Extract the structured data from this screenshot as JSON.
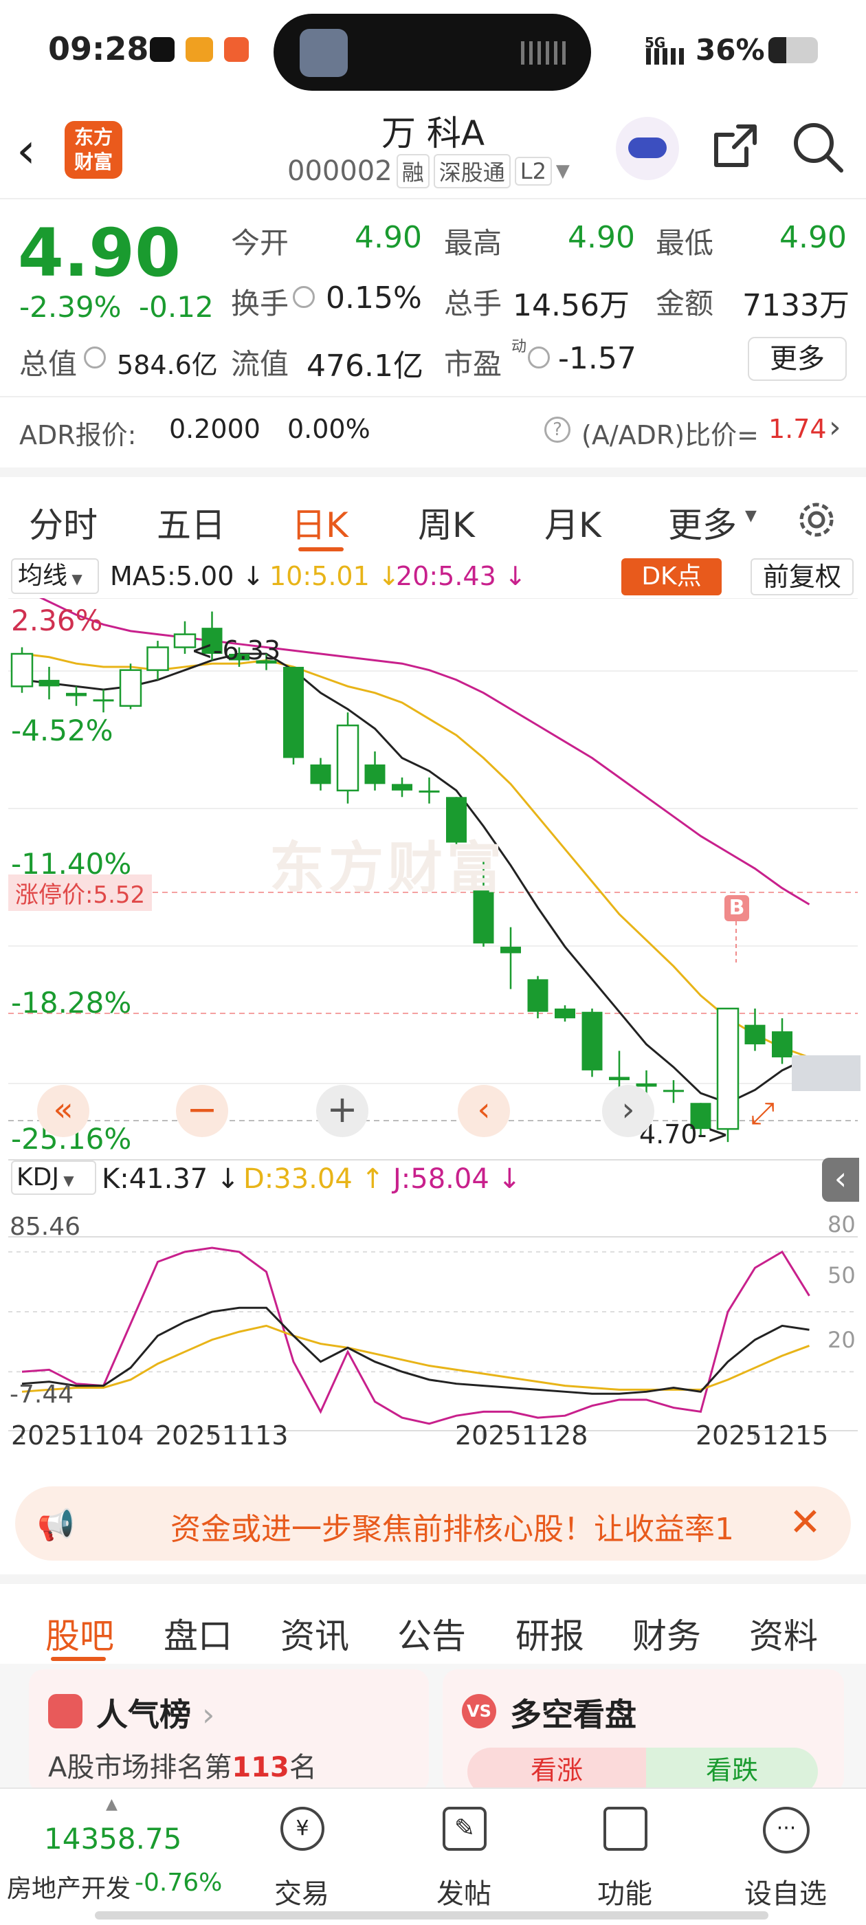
{
  "status": {
    "time": "09:28",
    "signal": "5G",
    "battery": "36%"
  },
  "nav": {
    "title": "万 科A",
    "code": "000002",
    "tags": [
      "融",
      "深股通",
      "L2"
    ],
    "logo_line1": "东方",
    "logo_line2": "财富"
  },
  "quote": {
    "price": "4.90",
    "change_pct": "-2.39%",
    "change_amt": "-0.12",
    "open_label": "今开",
    "open": "4.90",
    "high_label": "最高",
    "high": "4.90",
    "low_label": "最低",
    "low": "4.90",
    "turnover_label": "换手",
    "turnover": "0.15%",
    "volume_label": "总手",
    "volume": "14.56万",
    "amount_label": "金额",
    "amount": "7133万",
    "mcap_label": "总值",
    "mcap": "584.6亿",
    "float_label": "流值",
    "float": "476.1亿",
    "pe_label": "市盈",
    "pe_sup": "动",
    "pe": "-1.57",
    "more": "更多",
    "adr_label": "ADR报价:",
    "adr_price": "0.2000",
    "adr_pct": "0.00%",
    "adr_ratio_label": "(A/ADR)比价=",
    "adr_ratio": "1.74"
  },
  "tabs": [
    "分时",
    "五日",
    "日K",
    "周K",
    "月K",
    "更多"
  ],
  "chart_data": [
    {
      "type": "candlestick",
      "ma_label": "均线",
      "ma5": "MA5:5.00",
      "ma10": "10:5.01",
      "ma20": "20:5.43",
      "dk_label": "DK点",
      "adjust_label": "前复权",
      "y_ticks": [
        "2.36%",
        "-4.52%",
        "-11.40%",
        "-18.28%",
        "-25.16%"
      ],
      "limit_up_label": "涨停价:5.52",
      "high_annotation": "<-6.33",
      "low_annotation": "4.70->",
      "buy_marker": "B",
      "watermark": "东方财富",
      "candles": [
        {
          "o": 6.1,
          "c": 6.2,
          "h": 6.22,
          "l": 6.08
        },
        {
          "o": 6.12,
          "c": 6.1,
          "h": 6.16,
          "l": 6.06
        },
        {
          "o": 6.08,
          "c": 6.07,
          "h": 6.1,
          "l": 6.04
        },
        {
          "o": 6.06,
          "c": 6.06,
          "h": 6.09,
          "l": 6.02
        },
        {
          "o": 6.04,
          "c": 6.15,
          "h": 6.17,
          "l": 6.03
        },
        {
          "o": 6.15,
          "c": 6.22,
          "h": 6.24,
          "l": 6.12
        },
        {
          "o": 6.22,
          "c": 6.26,
          "h": 6.3,
          "l": 6.2
        },
        {
          "o": 6.28,
          "c": 6.2,
          "h": 6.33,
          "l": 6.18
        },
        {
          "o": 6.2,
          "c": 6.18,
          "h": 6.22,
          "l": 6.16
        },
        {
          "o": 6.18,
          "c": 6.17,
          "h": 6.2,
          "l": 6.15
        },
        {
          "o": 6.16,
          "c": 5.88,
          "h": 6.16,
          "l": 5.86
        },
        {
          "o": 5.86,
          "c": 5.8,
          "h": 5.88,
          "l": 5.78
        },
        {
          "o": 5.78,
          "c": 5.98,
          "h": 6.02,
          "l": 5.74
        },
        {
          "o": 5.86,
          "c": 5.8,
          "h": 5.9,
          "l": 5.78
        },
        {
          "o": 5.8,
          "c": 5.78,
          "h": 5.82,
          "l": 5.76
        },
        {
          "o": 5.78,
          "c": 5.78,
          "h": 5.82,
          "l": 5.74
        },
        {
          "o": 5.76,
          "c": 5.62,
          "h": 5.76,
          "l": 5.6
        },
        {
          "o": 5.48,
          "c": 5.31,
          "h": 5.57,
          "l": 5.3
        },
        {
          "o": 5.3,
          "c": 5.28,
          "h": 5.36,
          "l": 5.17
        },
        {
          "o": 5.2,
          "c": 5.1,
          "h": 5.21,
          "l": 5.08
        },
        {
          "o": 5.11,
          "c": 5.08,
          "h": 5.12,
          "l": 5.07
        },
        {
          "o": 5.1,
          "c": 4.92,
          "h": 5.11,
          "l": 4.9
        },
        {
          "o": 4.9,
          "c": 4.89,
          "h": 4.98,
          "l": 4.83
        },
        {
          "o": 4.88,
          "c": 4.87,
          "h": 4.92,
          "l": 4.82
        },
        {
          "o": 4.86,
          "c": 4.86,
          "h": 4.89,
          "l": 4.82
        },
        {
          "o": 4.82,
          "c": 4.74,
          "h": 4.82,
          "l": 4.72
        },
        {
          "o": 4.74,
          "c": 5.11,
          "h": 5.11,
          "l": 4.7
        },
        {
          "o": 5.06,
          "c": 5.0,
          "h": 5.11,
          "l": 4.98
        },
        {
          "o": 5.04,
          "c": 4.96,
          "h": 5.08,
          "l": 4.94
        },
        {
          "o": 4.9,
          "c": 4.9,
          "h": 4.9,
          "l": 4.9
        }
      ],
      "ma5_series": [
        6.12,
        6.11,
        6.1,
        6.09,
        6.1,
        6.12,
        6.15,
        6.18,
        6.2,
        6.2,
        6.15,
        6.08,
        6.03,
        5.97,
        5.88,
        5.84,
        5.78,
        5.67,
        5.55,
        5.42,
        5.3,
        5.2,
        5.1,
        5.0,
        4.93,
        4.85,
        4.82,
        4.86,
        4.92,
        4.96
      ],
      "ma10_series": [
        6.2,
        6.19,
        6.17,
        6.16,
        6.16,
        6.15,
        6.16,
        6.17,
        6.17,
        6.18,
        6.16,
        6.13,
        6.1,
        6.08,
        6.05,
        6.0,
        5.95,
        5.88,
        5.8,
        5.7,
        5.6,
        5.5,
        5.4,
        5.32,
        5.24,
        5.15,
        5.08,
        5.03,
        4.99,
        4.96
      ],
      "ma20_series": [
        6.4,
        6.36,
        6.32,
        6.29,
        6.27,
        6.26,
        6.25,
        6.24,
        6.23,
        6.22,
        6.21,
        6.2,
        6.19,
        6.18,
        6.17,
        6.15,
        6.12,
        6.08,
        6.03,
        5.98,
        5.93,
        5.88,
        5.82,
        5.76,
        5.7,
        5.64,
        5.59,
        5.54,
        5.48,
        5.43
      ]
    },
    {
      "type": "line",
      "indicator": "KDJ",
      "k_label": "K:41.37",
      "d_label": "D:33.04",
      "j_label": "J:58.04",
      "y_labels": [
        "85.46",
        "-7.44"
      ],
      "right_ticks": [
        "80",
        "50",
        "20"
      ],
      "dates": [
        "20251104",
        "20251113",
        "20251128",
        "20251215"
      ],
      "k": [
        14,
        15,
        13,
        13,
        22,
        38,
        45,
        50,
        52,
        52,
        38,
        25,
        32,
        25,
        20,
        16,
        14,
        13,
        12,
        11,
        10,
        9,
        9,
        10,
        12,
        10,
        25,
        36,
        43,
        41
      ],
      "d": [
        10,
        11,
        12,
        12,
        16,
        24,
        30,
        36,
        40,
        43,
        38,
        34,
        32,
        29,
        26,
        23,
        21,
        19,
        17,
        15,
        13,
        12,
        11,
        11,
        11,
        11,
        16,
        22,
        28,
        33
      ],
      "j": [
        20,
        21,
        14,
        13,
        44,
        75,
        80,
        82,
        80,
        70,
        25,
        0,
        30,
        5,
        -3,
        -6,
        -2,
        0,
        0,
        -3,
        -2,
        3,
        6,
        6,
        2,
        0,
        50,
        72,
        80,
        58
      ]
    }
  ],
  "banner": {
    "text": "资金或进一步聚焦前排核心股！让收益率1"
  },
  "bottom_tabs": [
    "股吧",
    "盘口",
    "资讯",
    "公告",
    "研报",
    "财务",
    "资料"
  ],
  "cards": {
    "popular_title": "人气榜",
    "popular_sub_pre": "A股市场排名第",
    "popular_rank": "113",
    "popular_sub_post": "名",
    "bull_title": "多空看盘",
    "bull_btn": "看涨",
    "bear_btn": "看跌"
  },
  "bottom_bar": {
    "index_value": "14358.75",
    "index_name": "房地产开发",
    "index_change": "-0.76%",
    "items": [
      "交易",
      "发帖",
      "功能",
      "设自选"
    ]
  }
}
